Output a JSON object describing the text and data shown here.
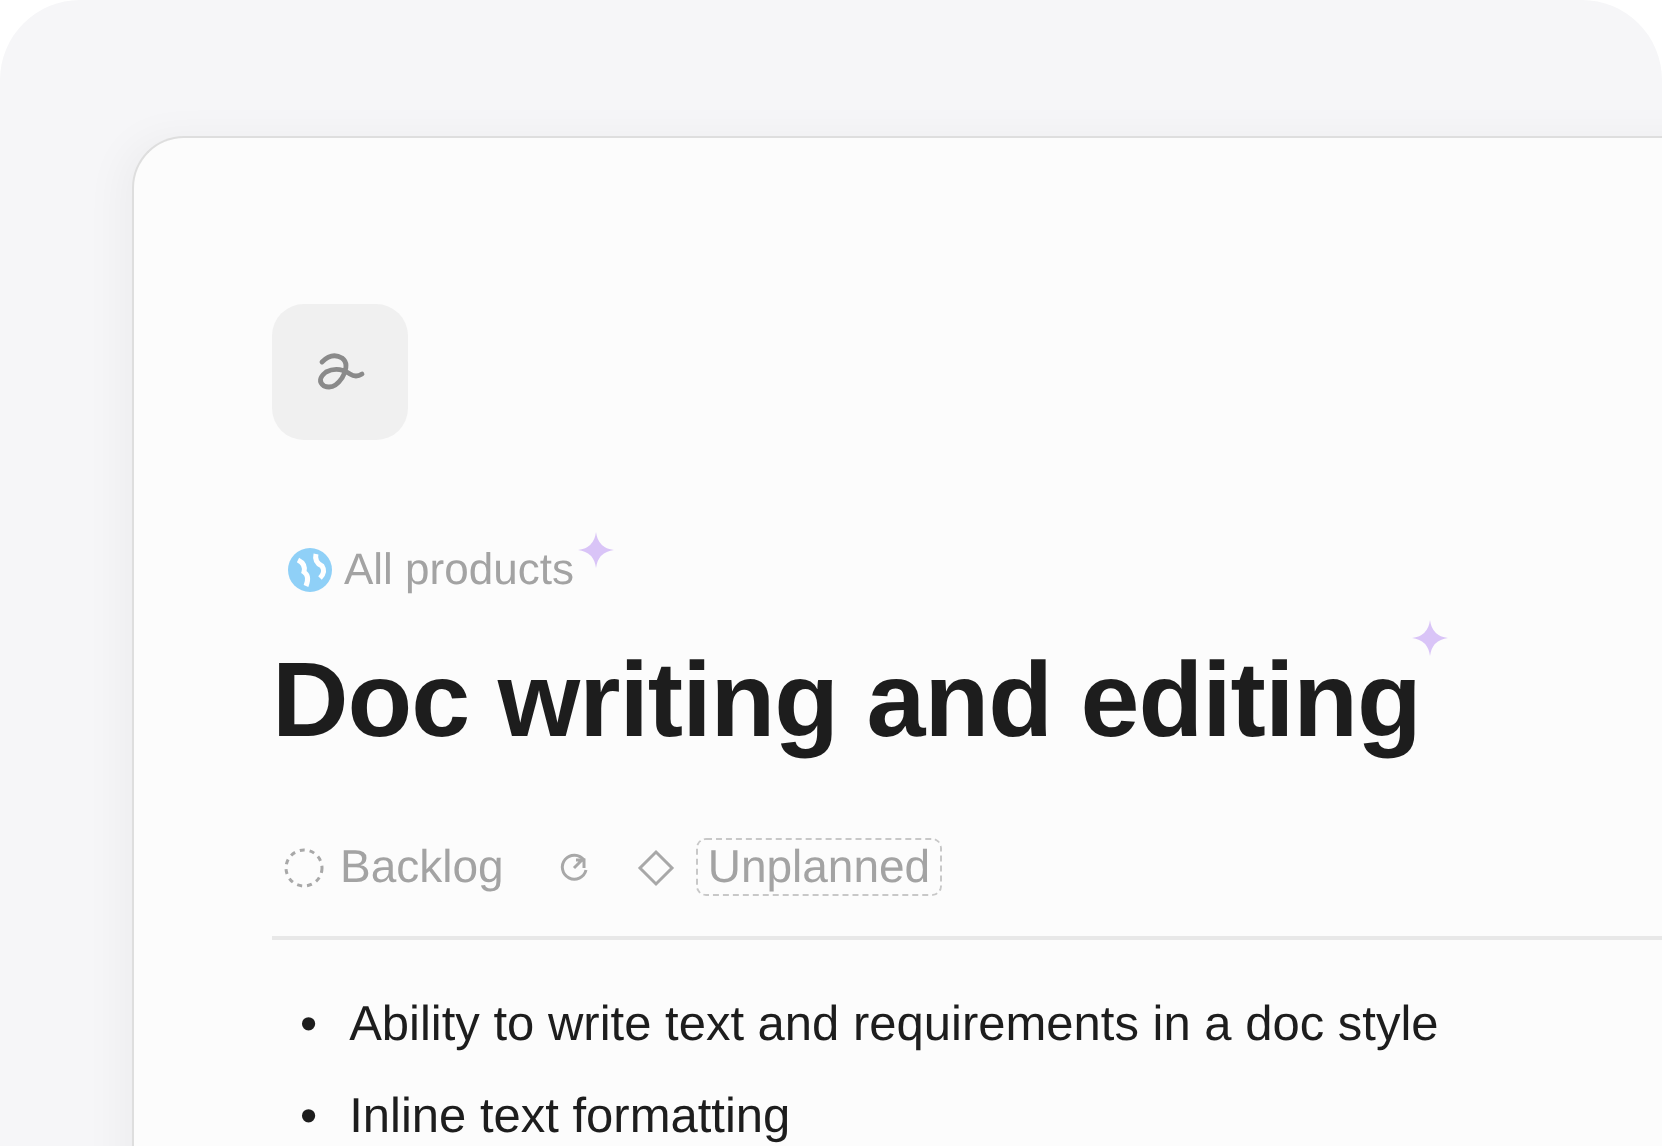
{
  "breadcrumb": {
    "label": "All products"
  },
  "title": "Doc writing and editing",
  "properties": {
    "status": "Backlog",
    "target": "Unplanned"
  },
  "bullets": [
    {
      "marker": "•",
      "text": "Ability to write text and requirements in a doc style"
    },
    {
      "marker": "•",
      "text": "Inline text formatting"
    }
  ]
}
